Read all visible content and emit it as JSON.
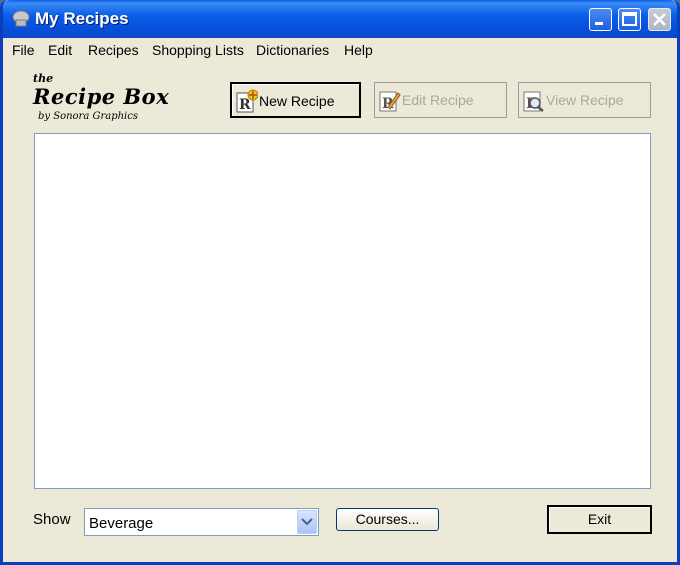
{
  "window": {
    "title": "My Recipes"
  },
  "menu": [
    "File",
    "Edit",
    "Recipes",
    "Shopping Lists",
    "Dictionaries",
    "Help"
  ],
  "logo": {
    "the": "the",
    "main": "Recipe Box",
    "by": "by Sonora Graphics"
  },
  "toolbar": {
    "new_recipe": "New Recipe",
    "edit_recipe": "Edit Recipe",
    "view_recipe": "View Recipe"
  },
  "recipe_list": {
    "items": []
  },
  "filter": {
    "show_label": "Show",
    "selected": "Beverage",
    "courses_label": "Courses...",
    "exit_label": "Exit"
  },
  "colors": {
    "titlebar": "#0a5ce6",
    "window_bg": "#ece9d8",
    "disabled_text": "#a9a79e"
  }
}
